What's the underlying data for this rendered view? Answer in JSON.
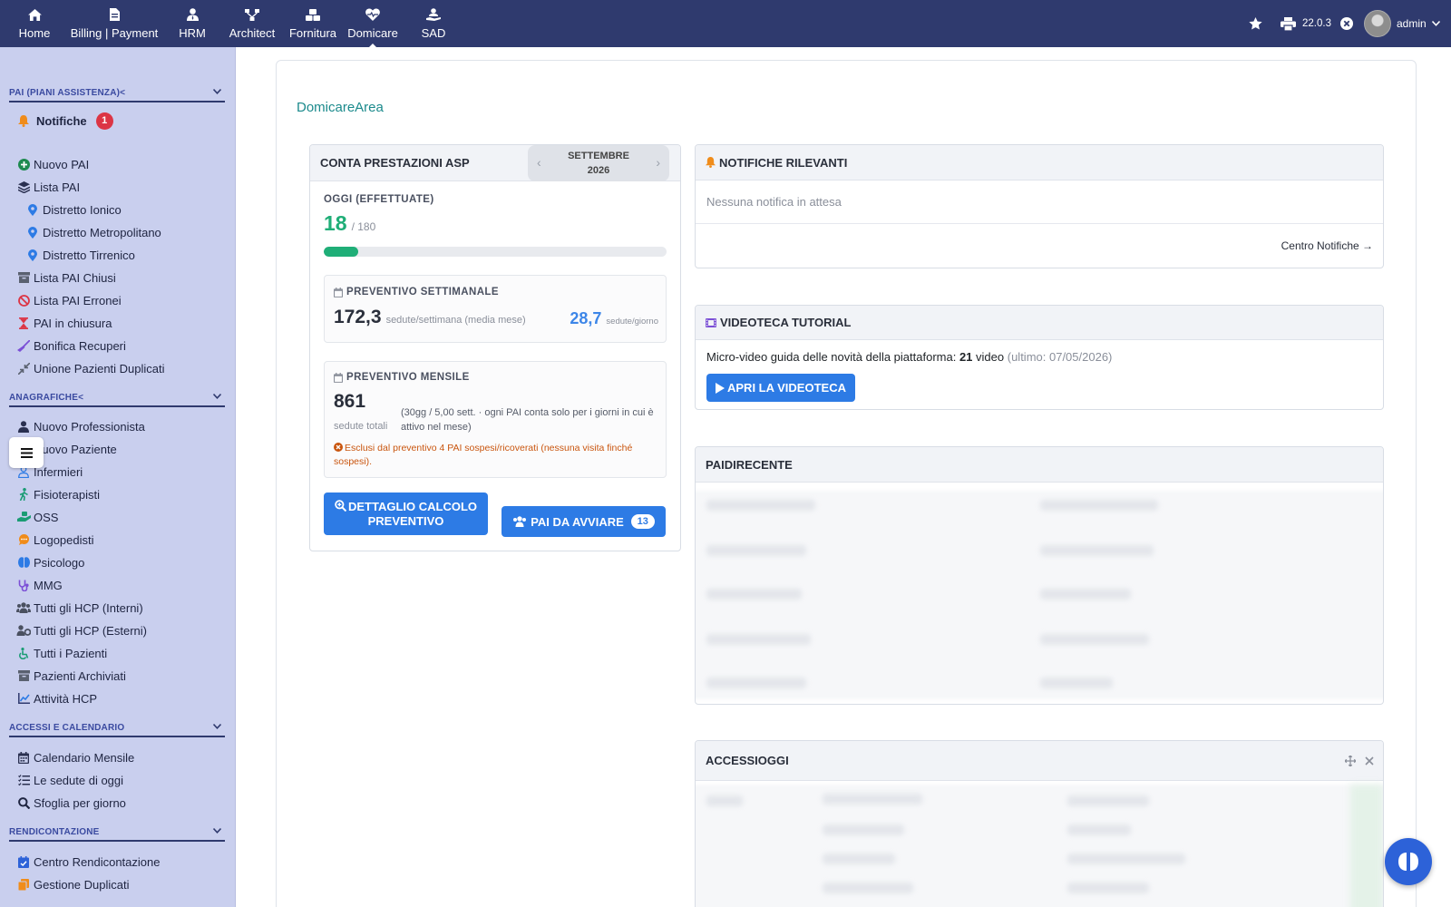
{
  "topnav": {
    "items": [
      {
        "label": "Home",
        "icon": "home-icon"
      },
      {
        "label": "Billing | Payment",
        "icon": "invoice-icon"
      },
      {
        "label": "HRM",
        "icon": "user-tie-icon"
      },
      {
        "label": "Architect",
        "icon": "sitemap-icon"
      },
      {
        "label": "Fornitura",
        "icon": "boxes-icon"
      },
      {
        "label": "Domicare",
        "icon": "heart-pulse-icon"
      },
      {
        "label": "SAD",
        "icon": "user-hand-icon"
      }
    ],
    "version": "22.0.3",
    "user": "admin"
  },
  "sidebar": {
    "sections": {
      "pai": "PAI (PIANI ASSISTENZA)<",
      "anagrafiche": "ANAGRAFICHE<",
      "accessi": "ACCESSI E CALENDARIO",
      "rendicontazione": "RENDICONTAZIONE"
    },
    "notifiche": {
      "label": "Notifiche",
      "count": "1"
    },
    "pai_items": [
      "Nuovo PAI",
      "Lista PAI",
      "Distretto Ionico",
      "Distretto Metropolitano",
      "Distretto Tirrenico",
      "Lista PAI Chiusi",
      "Lista PAI Erronei",
      "PAI in chiusura",
      "Bonifica Recuperi",
      "Unione Pazienti Duplicati"
    ],
    "anagrafiche_items": [
      "Nuovo Professionista",
      "Nuovo Paziente",
      "Infermieri",
      "Fisioterapisti",
      "OSS",
      "Logopedisti",
      "Psicologo",
      "MMG",
      "Tutti gli HCP (Interni)",
      "Tutti gli HCP (Esterni)",
      "Tutti i Pazienti",
      "Pazienti Archiviati",
      "Attività HCP"
    ],
    "accessi_items": [
      "Calendario Mensile",
      "Le sedute di oggi",
      "Sfoglia per giorno"
    ],
    "rendicontazione_items": [
      "Centro Rendicontazione",
      "Gestione Duplicati"
    ]
  },
  "main": {
    "area_title": "DomicareArea",
    "prestazioni": {
      "title": "CONTA PRESTAZIONI ASP",
      "month": "SETTEMBRE",
      "year": "2026",
      "oggi_label": "OGGI (EFFETTUATE)",
      "oggi_value": "18",
      "oggi_total": "/ 180",
      "progress": 0.1,
      "settimanale_label": "PREVENTIVO SETTIMANALE",
      "settimanale_value": "172,3",
      "settimanale_unit": "sedute/settimana (media mese)",
      "giorno_value": "28,7",
      "giorno_unit": "sedute/giorno",
      "mensile_label": "PREVENTIVO MENSILE",
      "mensile_value": "861",
      "mensile_unit": "sedute totali",
      "mensile_note": "(30gg / 5,00 sett. · ogni PAI conta solo per i giorni in cui è attivo nel mese)",
      "warning": "Esclusi dal preventivo 4 PAI sospesi/ricoverati (nessuna visita finché sospesi).",
      "btn_dettaglio": "DETTAGLIO CALCOLO PREVENTIVO",
      "btn_avviare": "PAI DA AVVIARE",
      "avviare_count": "13"
    },
    "notifiche": {
      "title": "NOTIFICHE RILEVANTI",
      "empty": "Nessuna notifica in attesa",
      "link": "Centro Notifiche →"
    },
    "videoteca": {
      "title": "VIDEOTECA TUTORIAL",
      "text_prefix": "Micro-video guida delle novità della piattaforma:",
      "count": "21",
      "text_suffix": "video",
      "last": "(ultimo: 07/05/2026)",
      "button": "APRI LA VIDEOTECA"
    },
    "pai_recente": {
      "title": "PAIDIRECENTE"
    },
    "accessi_oggi": {
      "title": "ACCESSIOGGI"
    }
  },
  "colors": {
    "navbar": "#2f3a6e",
    "sidebar": "#c9cfee",
    "accent": "#2d7be5",
    "success": "#1fae77",
    "danger": "#dc3545",
    "teal": "#1b8a8c"
  }
}
